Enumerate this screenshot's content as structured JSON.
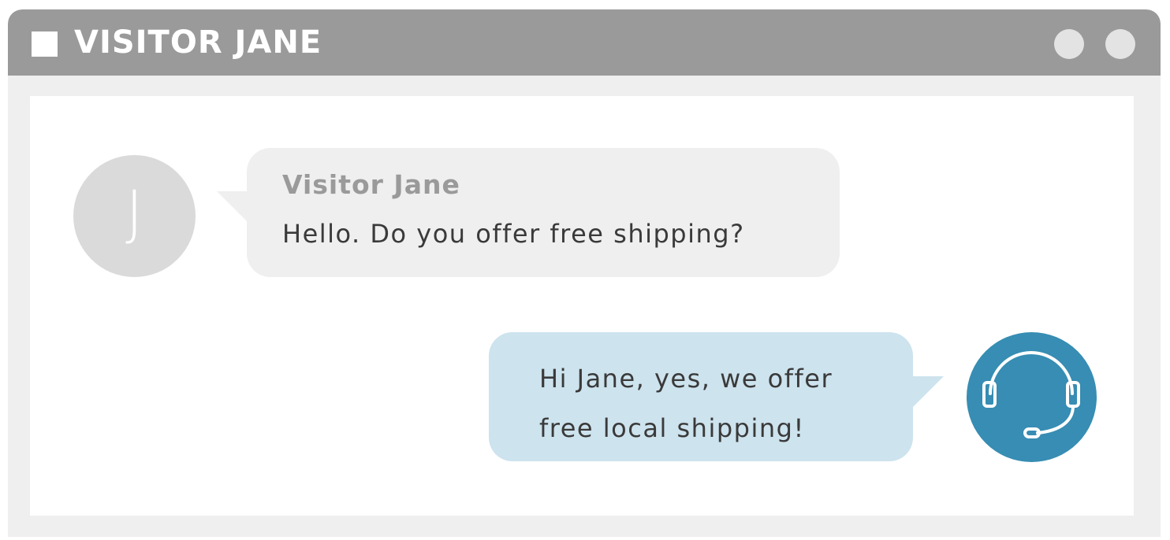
{
  "window": {
    "title": "VISITOR JANE",
    "title_icon": "square-icon",
    "buttons": [
      "window-button-1",
      "window-button-2"
    ]
  },
  "chat": {
    "incoming": {
      "avatar_initial": "J",
      "sender": "Visitor Jane",
      "message": "Hello. Do you offer free shipping?"
    },
    "outgoing": {
      "message": "Hi Jane, yes, we offer\nfree local shipping!",
      "avatar_icon": "headset-icon"
    }
  },
  "colors": {
    "titlebar": "#9a9a9a",
    "frame": "#efefef",
    "incoming_bubble": "#efefef",
    "outgoing_bubble": "#cde3ee",
    "agent_avatar": "#378db3",
    "visitor_avatar": "#dadada"
  }
}
